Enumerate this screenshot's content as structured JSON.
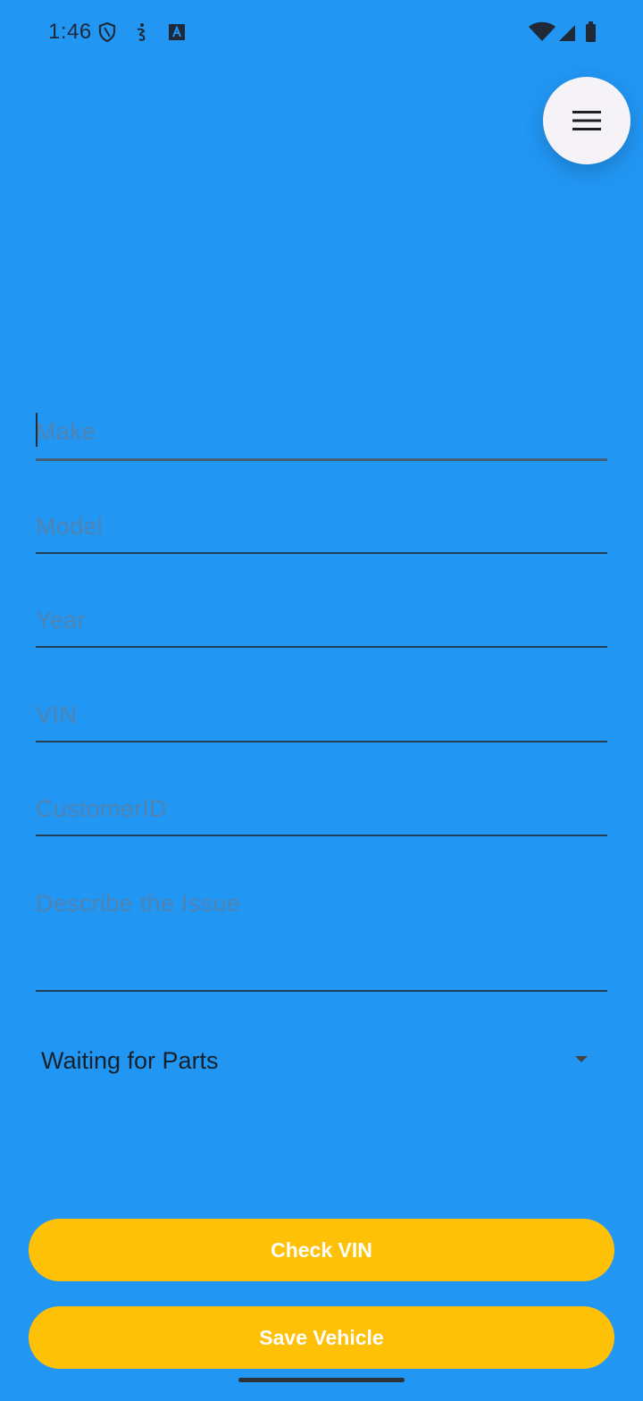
{
  "status_bar": {
    "time": "1:46",
    "left_icons": [
      "shield-icon",
      "accessibility-icon",
      "notification-a-icon"
    ],
    "right_icons": [
      "wifi-icon",
      "signal-icon",
      "battery-icon"
    ]
  },
  "menu": {
    "icon": "hamburger-menu-icon"
  },
  "form": {
    "make_placeholder": "Make",
    "model_placeholder": "Model",
    "year_placeholder": "Year",
    "vin_placeholder": "VIN",
    "customer_id_placeholder": "CustomerID",
    "issue_placeholder": "Describe the Issue"
  },
  "status_dropdown": {
    "value": "Waiting for Parts"
  },
  "buttons": {
    "check_vin": "Check VIN",
    "save_vehicle": "Save Vehicle"
  },
  "colors": {
    "background": "#2196F3",
    "button": "#FFC107",
    "button_text": "#FFFFFF",
    "fab": "#F5F3F7"
  }
}
